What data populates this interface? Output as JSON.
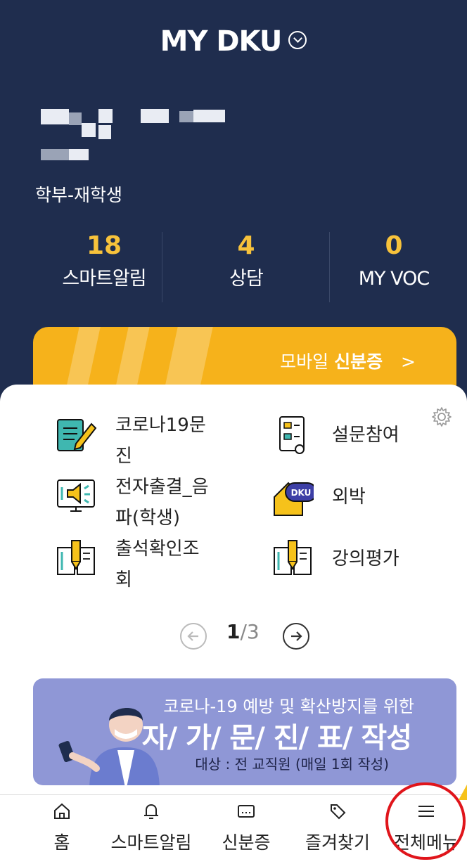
{
  "header": {
    "title": "MY DKU",
    "role": "학부-재학생"
  },
  "stats": [
    {
      "value": "18",
      "label": "스마트알림"
    },
    {
      "value": "4",
      "label": "상담"
    },
    {
      "value": "0",
      "label": "MY VOC"
    }
  ],
  "id_card_button": {
    "prefix": "모바일",
    "bold": "신분증",
    "chevron": ">"
  },
  "quick_menu": {
    "items": [
      {
        "label": "코로나19문진",
        "icon": "corona-checklist-icon"
      },
      {
        "label": "설문참여",
        "icon": "survey-icon"
      },
      {
        "label": "전자출결_음파(학생)",
        "icon": "e-attendance-icon"
      },
      {
        "label": "외박",
        "icon": "overnight-house-icon"
      },
      {
        "label": "출석확인조회",
        "icon": "attendance-book-icon"
      },
      {
        "label": "강의평가",
        "icon": "lecture-evaluation-book-icon"
      }
    ],
    "badge_text": "DKU",
    "pager": {
      "current": "1",
      "separator": "/",
      "total": "3"
    }
  },
  "banner": {
    "line1": "코로나-19 예방 및 확산방지를 위한",
    "line2": "자/ 가/ 문/ 진/ 표/ 작성",
    "line3": "대상 : 전 교직원 (매일 1회 작성)"
  },
  "tabbar": [
    {
      "label": "홈",
      "icon": "home-icon"
    },
    {
      "label": "스마트알림",
      "icon": "bell-icon"
    },
    {
      "label": "신분증",
      "icon": "id-card-icon"
    },
    {
      "label": "즐겨찾기",
      "icon": "tag-icon"
    },
    {
      "label": "전체메뉴",
      "icon": "hamburger-menu-icon"
    }
  ],
  "colors": {
    "navy": "#1f2d4e",
    "accent": "#f7c23b",
    "banner": "#8f97d6",
    "highlight": "#e0151b"
  }
}
